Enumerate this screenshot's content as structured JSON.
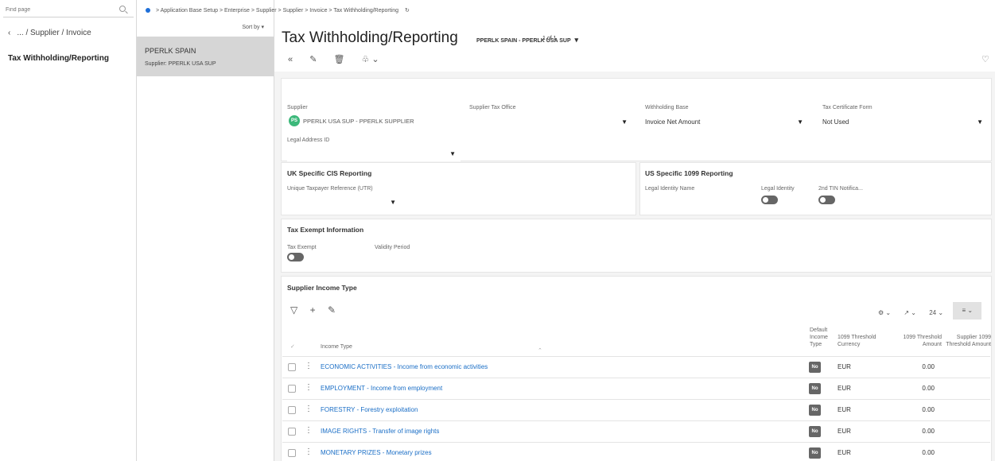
{
  "nav": {
    "find_placeholder": "Find page",
    "back_label": "... / Supplier / Invoice",
    "current_item": "Tax Withholding/Reporting"
  },
  "record_list": {
    "sort_label": "Sort by",
    "records": [
      {
        "title": "PPERLK SPAIN",
        "subtitle": "Supplier:  PPERLK USA SUP"
      }
    ]
  },
  "breadcrumb": {
    "items": [
      "Application Base Setup",
      "Enterprise",
      "Supplier",
      "Supplier",
      "Invoice",
      "Tax Withholding/Reporting"
    ]
  },
  "header": {
    "title": "Tax Withholding/Reporting",
    "record": "PPERLK SPAIN - PPERLK USA SUP",
    "count": "1 of 1"
  },
  "colors": {
    "accent": "#1e6fd9",
    "link": "#1a6ec6",
    "avatar": "#3cb87a",
    "toggle_off": "#666666"
  },
  "general": {
    "supplier_label": "Supplier",
    "supplier_avatar": "PS",
    "supplier_value": "PPERLK USA SUP - PPERLK SUPPLIER",
    "tax_office_label": "Supplier Tax Office",
    "tax_office_value": "",
    "withholding_base_label": "Withholding Base",
    "withholding_base_value": "Invoice Net Amount",
    "tax_cert_label": "Tax Certificate Form",
    "tax_cert_value": "Not Used",
    "legal_address_label": "Legal Address ID",
    "legal_address_value": ""
  },
  "uk_cis": {
    "title": "UK Specific CIS Reporting",
    "utr_label": "Unique Taxpayer Reference (UTR)"
  },
  "us_1099": {
    "title": "US Specific 1099 Reporting",
    "legal_identity_name_label": "Legal Identity Name",
    "legal_identity_label": "Legal Identity",
    "tin_label": "2nd TIN Notifica...",
    "legal_identity_on": false,
    "tin_on": false
  },
  "tax_exempt": {
    "title": "Tax Exempt Information",
    "exempt_label": "Tax Exempt",
    "validity_label": "Validity Period",
    "exempt_on": false
  },
  "income_type": {
    "title": "Supplier Income Type",
    "page_size": "24",
    "columns": {
      "income_type": "Income Type",
      "default_income_type": "Default Income Type",
      "threshold_currency": "1099 Threshold Currency",
      "threshold_amount": "1099 Threshold Amount",
      "supplier_threshold_amount": "Supplier 1099 Threshold Amount"
    },
    "rows": [
      {
        "income_type": "ECONOMIC ACTIVITIES - Income from economic activities",
        "default": "No",
        "currency": "EUR",
        "amount": "0.00"
      },
      {
        "income_type": "EMPLOYMENT - Income from employment",
        "default": "No",
        "currency": "EUR",
        "amount": "0.00"
      },
      {
        "income_type": "FORESTRY - Forestry exploitation",
        "default": "No",
        "currency": "EUR",
        "amount": "0.00"
      },
      {
        "income_type": "IMAGE RIGHTS - Transfer of image rights",
        "default": "No",
        "currency": "EUR",
        "amount": "0.00"
      },
      {
        "income_type": "MONETARY PRIZES - Monetary prizes",
        "default": "No",
        "currency": "EUR",
        "amount": "0.00"
      }
    ]
  }
}
